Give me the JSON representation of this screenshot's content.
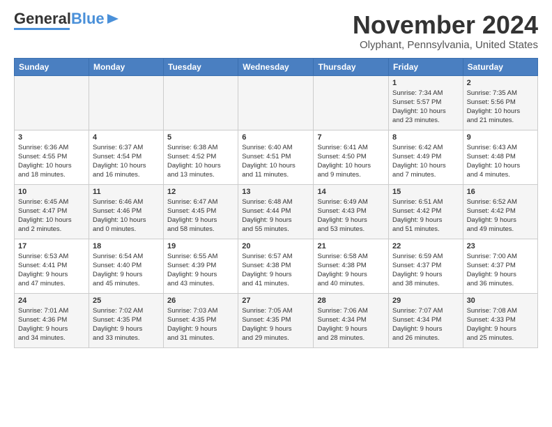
{
  "header": {
    "logo_general": "General",
    "logo_blue": "Blue",
    "month_title": "November 2024",
    "location": "Olyphant, Pennsylvania, United States"
  },
  "columns": [
    "Sunday",
    "Monday",
    "Tuesday",
    "Wednesday",
    "Thursday",
    "Friday",
    "Saturday"
  ],
  "weeks": [
    [
      {
        "day": "",
        "info": ""
      },
      {
        "day": "",
        "info": ""
      },
      {
        "day": "",
        "info": ""
      },
      {
        "day": "",
        "info": ""
      },
      {
        "day": "",
        "info": ""
      },
      {
        "day": "1",
        "info": "Sunrise: 7:34 AM\nSunset: 5:57 PM\nDaylight: 10 hours\nand 23 minutes."
      },
      {
        "day": "2",
        "info": "Sunrise: 7:35 AM\nSunset: 5:56 PM\nDaylight: 10 hours\nand 21 minutes."
      }
    ],
    [
      {
        "day": "3",
        "info": "Sunrise: 6:36 AM\nSunset: 4:55 PM\nDaylight: 10 hours\nand 18 minutes."
      },
      {
        "day": "4",
        "info": "Sunrise: 6:37 AM\nSunset: 4:54 PM\nDaylight: 10 hours\nand 16 minutes."
      },
      {
        "day": "5",
        "info": "Sunrise: 6:38 AM\nSunset: 4:52 PM\nDaylight: 10 hours\nand 13 minutes."
      },
      {
        "day": "6",
        "info": "Sunrise: 6:40 AM\nSunset: 4:51 PM\nDaylight: 10 hours\nand 11 minutes."
      },
      {
        "day": "7",
        "info": "Sunrise: 6:41 AM\nSunset: 4:50 PM\nDaylight: 10 hours\nand 9 minutes."
      },
      {
        "day": "8",
        "info": "Sunrise: 6:42 AM\nSunset: 4:49 PM\nDaylight: 10 hours\nand 7 minutes."
      },
      {
        "day": "9",
        "info": "Sunrise: 6:43 AM\nSunset: 4:48 PM\nDaylight: 10 hours\nand 4 minutes."
      }
    ],
    [
      {
        "day": "10",
        "info": "Sunrise: 6:45 AM\nSunset: 4:47 PM\nDaylight: 10 hours\nand 2 minutes."
      },
      {
        "day": "11",
        "info": "Sunrise: 6:46 AM\nSunset: 4:46 PM\nDaylight: 10 hours\nand 0 minutes."
      },
      {
        "day": "12",
        "info": "Sunrise: 6:47 AM\nSunset: 4:45 PM\nDaylight: 9 hours\nand 58 minutes."
      },
      {
        "day": "13",
        "info": "Sunrise: 6:48 AM\nSunset: 4:44 PM\nDaylight: 9 hours\nand 55 minutes."
      },
      {
        "day": "14",
        "info": "Sunrise: 6:49 AM\nSunset: 4:43 PM\nDaylight: 9 hours\nand 53 minutes."
      },
      {
        "day": "15",
        "info": "Sunrise: 6:51 AM\nSunset: 4:42 PM\nDaylight: 9 hours\nand 51 minutes."
      },
      {
        "day": "16",
        "info": "Sunrise: 6:52 AM\nSunset: 4:42 PM\nDaylight: 9 hours\nand 49 minutes."
      }
    ],
    [
      {
        "day": "17",
        "info": "Sunrise: 6:53 AM\nSunset: 4:41 PM\nDaylight: 9 hours\nand 47 minutes."
      },
      {
        "day": "18",
        "info": "Sunrise: 6:54 AM\nSunset: 4:40 PM\nDaylight: 9 hours\nand 45 minutes."
      },
      {
        "day": "19",
        "info": "Sunrise: 6:55 AM\nSunset: 4:39 PM\nDaylight: 9 hours\nand 43 minutes."
      },
      {
        "day": "20",
        "info": "Sunrise: 6:57 AM\nSunset: 4:38 PM\nDaylight: 9 hours\nand 41 minutes."
      },
      {
        "day": "21",
        "info": "Sunrise: 6:58 AM\nSunset: 4:38 PM\nDaylight: 9 hours\nand 40 minutes."
      },
      {
        "day": "22",
        "info": "Sunrise: 6:59 AM\nSunset: 4:37 PM\nDaylight: 9 hours\nand 38 minutes."
      },
      {
        "day": "23",
        "info": "Sunrise: 7:00 AM\nSunset: 4:37 PM\nDaylight: 9 hours\nand 36 minutes."
      }
    ],
    [
      {
        "day": "24",
        "info": "Sunrise: 7:01 AM\nSunset: 4:36 PM\nDaylight: 9 hours\nand 34 minutes."
      },
      {
        "day": "25",
        "info": "Sunrise: 7:02 AM\nSunset: 4:35 PM\nDaylight: 9 hours\nand 33 minutes."
      },
      {
        "day": "26",
        "info": "Sunrise: 7:03 AM\nSunset: 4:35 PM\nDaylight: 9 hours\nand 31 minutes."
      },
      {
        "day": "27",
        "info": "Sunrise: 7:05 AM\nSunset: 4:35 PM\nDaylight: 9 hours\nand 29 minutes."
      },
      {
        "day": "28",
        "info": "Sunrise: 7:06 AM\nSunset: 4:34 PM\nDaylight: 9 hours\nand 28 minutes."
      },
      {
        "day": "29",
        "info": "Sunrise: 7:07 AM\nSunset: 4:34 PM\nDaylight: 9 hours\nand 26 minutes."
      },
      {
        "day": "30",
        "info": "Sunrise: 7:08 AM\nSunset: 4:33 PM\nDaylight: 9 hours\nand 25 minutes."
      }
    ]
  ]
}
